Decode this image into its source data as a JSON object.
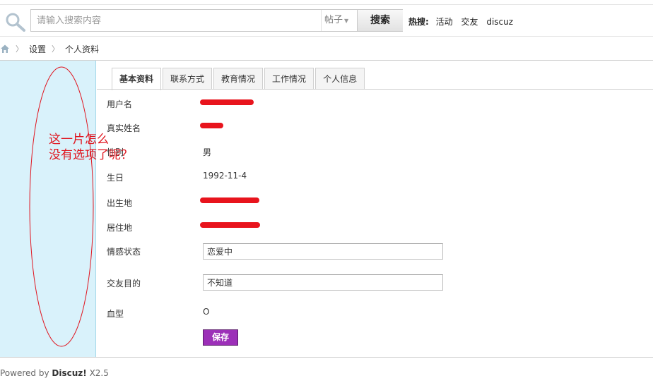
{
  "search": {
    "placeholder": "请输入搜索内容",
    "type_label": "帖子",
    "button_label": "搜索",
    "hot_label": "热搜:",
    "hot_links": [
      "活动",
      "交友",
      "discuz"
    ]
  },
  "breadcrumb": {
    "home_icon": "home-icon",
    "items": [
      "设置",
      "个人资料"
    ]
  },
  "tabs": [
    {
      "label": "基本资料",
      "active": true
    },
    {
      "label": "联系方式",
      "active": false
    },
    {
      "label": "教育情况",
      "active": false
    },
    {
      "label": "工作情况",
      "active": false
    },
    {
      "label": "个人信息",
      "active": false
    }
  ],
  "form": {
    "username_label": "用户名",
    "realname_label": "真实姓名",
    "gender_label": "性别",
    "gender_value": "男",
    "birthday_label": "生日",
    "birthday_value": "1992-11-4",
    "birthplace_label": "出生地",
    "residence_label": "居住地",
    "relationship_label": "情感状态",
    "relationship_value": "恋爱中",
    "purpose_label": "交友目的",
    "purpose_value": "不知道",
    "bloodtype_label": "血型",
    "bloodtype_value": "O",
    "save_label": "保存"
  },
  "annotation": {
    "line1": "这一片怎么",
    "line2": "没有选项了呢？",
    "color": "#e0141e"
  },
  "footer": {
    "prefix": "Powered by",
    "brand": "Discuz!",
    "version": "X2.5"
  },
  "colors": {
    "sidebar_bg": "#d9f2fb",
    "save_button": "#9c2fb8",
    "redaction": "#e8141d"
  }
}
